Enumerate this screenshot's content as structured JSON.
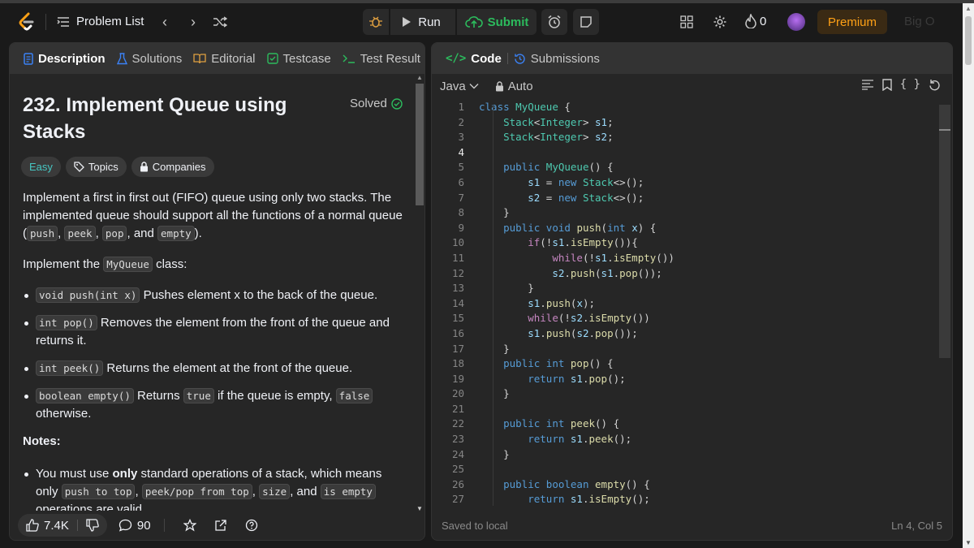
{
  "nav": {
    "problem_list_label": "Problem List",
    "run_label": "Run",
    "submit_label": "Submit",
    "streak_count": "0",
    "premium_label": "Premium",
    "bigo_label": "Big O"
  },
  "left_tabs": [
    {
      "label": "Description"
    },
    {
      "label": "Solutions"
    },
    {
      "label": "Editorial"
    },
    {
      "label": "Testcase"
    },
    {
      "label": "Test Result"
    }
  ],
  "problem": {
    "title": "232. Implement Queue using Stacks",
    "status": "Solved",
    "difficulty": "Easy",
    "topics_label": "Topics",
    "companies_label": "Companies",
    "intro_1": "Implement a first in first out (FIFO) queue using only two stacks. The implemented queue should support all the functions of a normal queue (",
    "intro_push": "push",
    "intro_peek": "peek",
    "intro_pop": "pop",
    "intro_empty": "empty",
    "intro_and": ", and ",
    "intro_end": ").",
    "impl_1": "Implement the ",
    "impl_class": "MyQueue",
    "impl_2": " class:",
    "b1_code": "void push(int x)",
    "b1_text": " Pushes element x to the back of the queue.",
    "b2_code": "int pop()",
    "b2_text": " Removes the element from the front of the queue and returns it.",
    "b3_code": "int peek()",
    "b3_text": " Returns the element at the front of the queue.",
    "b4_code": "boolean empty()",
    "b4_text1": " Returns ",
    "b4_true": "true",
    "b4_text2": " if the queue is empty, ",
    "b4_false": "false",
    "b4_text3": " otherwise.",
    "notes_label": "Notes:",
    "n1_a": "You must use ",
    "n1_only": "only",
    "n1_b": " standard operations of a stack, which means only ",
    "n1_c1": "push to top",
    "n1_c2": "peek/pop from top",
    "n1_c3": "size",
    "n1_and": ", and ",
    "n1_c4": "is empty",
    "n1_d": " operations are valid."
  },
  "left_footer": {
    "likes": "7.4K",
    "comments": "90"
  },
  "right_tabs": [
    {
      "label": "Code"
    },
    {
      "label": "Submissions"
    }
  ],
  "editor": {
    "language": "Java",
    "mode": "Auto",
    "current_line": 4,
    "status_left": "Saved to local",
    "status_right": "Ln 4, Col 5",
    "lines": [
      "class MyQueue {",
      "    Stack<Integer> s1;",
      "    Stack<Integer> s2;",
      "",
      "    public MyQueue() {",
      "        s1 = new Stack<>();",
      "        s2 = new Stack<>();",
      "    }",
      "    public void push(int x) {",
      "        if(!s1.isEmpty()){",
      "            while(!s1.isEmpty())",
      "            s2.push(s1.pop());",
      "        }",
      "        s1.push(x);",
      "        while(!s2.isEmpty())",
      "        s1.push(s2.pop());",
      "    }",
      "    public int pop() {",
      "        return s1.pop();",
      "    }",
      "",
      "    public int peek() {",
      "        return s1.peek();",
      "    }",
      "",
      "    public boolean empty() {",
      "        return s1.isEmpty();"
    ]
  },
  "colors": {
    "accent_green": "#2cbb5d",
    "easy_teal": "#46c6c2",
    "premium_orange": "#ffa116"
  }
}
